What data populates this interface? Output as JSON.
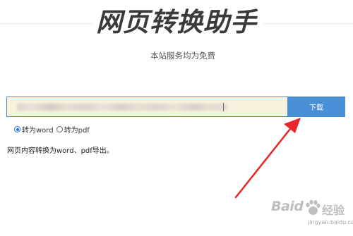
{
  "header": {
    "title": "网页转换助手",
    "subtitle": "本站服务均为免费"
  },
  "download_bar": {
    "input_value": "",
    "button_label": "下载"
  },
  "format_options": [
    {
      "label": "转为word",
      "selected": true
    },
    {
      "label": "转为pdf",
      "selected": false
    }
  ],
  "description": "网页内容转换为word、pdf导出。",
  "annotation": {
    "arrow_color": "#e8262b"
  },
  "watermark": {
    "logo_text": "Baid",
    "brand_text": "经验",
    "url_text": "jingyan.baidu.com"
  },
  "colors": {
    "accent": "#4a90d6",
    "input_background": "#f8f1de"
  }
}
